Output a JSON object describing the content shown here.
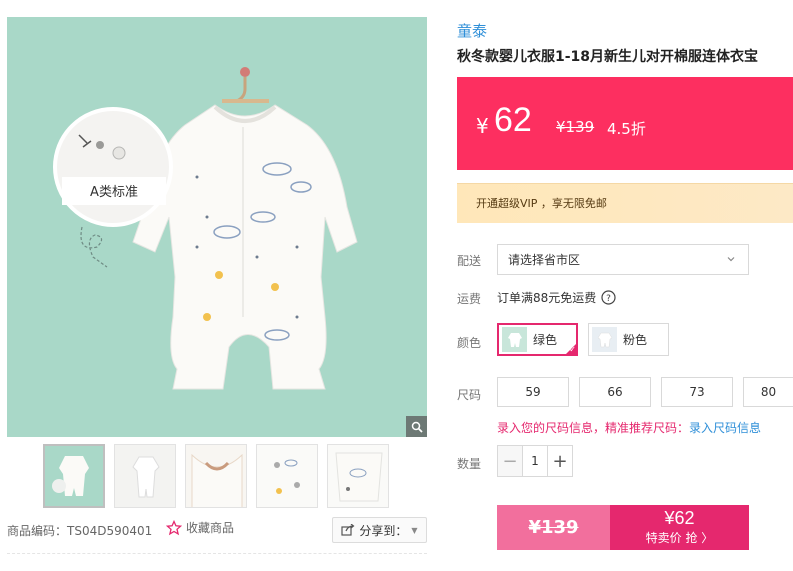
{
  "gallery": {
    "image_badge_text": "A类标准",
    "thumbnails": [
      "thumb-1",
      "thumb-2",
      "thumb-3",
      "thumb-4",
      "thumb-5"
    ],
    "product_code": "商品编码：TS04D590401",
    "favorite_label": "收藏商品",
    "share_label": "分享到："
  },
  "product": {
    "brand": "童泰",
    "title": "秋冬款婴儿衣服1-18月新生儿对开棉服连体衣宝"
  },
  "price": {
    "currency": "¥",
    "current": "62",
    "original": "¥139",
    "discount": "4.5折"
  },
  "vip": {
    "text": "开通超级VIP ，享无限免邮"
  },
  "delivery": {
    "label": "配送",
    "placeholder": "请选择省市区",
    "fee_label": "运费",
    "fee_text": "订单满88元免运费"
  },
  "colors": {
    "label": "颜色",
    "options": [
      {
        "name": "绿色",
        "selected": true
      },
      {
        "name": "粉色",
        "selected": false
      }
    ]
  },
  "sizes": {
    "label": "尺码",
    "options": [
      "59",
      "66",
      "73",
      "80"
    ],
    "tip_text": "录入您的尺码信息，精准推荐尺码：",
    "tip_link": "录入尺码信息"
  },
  "quantity": {
    "label": "数量",
    "value": "1",
    "minus": "−",
    "plus": "+"
  },
  "buy": {
    "original_price": "¥139",
    "special_price": "¥62",
    "special_label": "特卖价 抢 〉"
  },
  "colors_theme": {
    "price_bg": "#fd2f60",
    "accent": "#e5286e",
    "link": "#2f8fd8"
  }
}
